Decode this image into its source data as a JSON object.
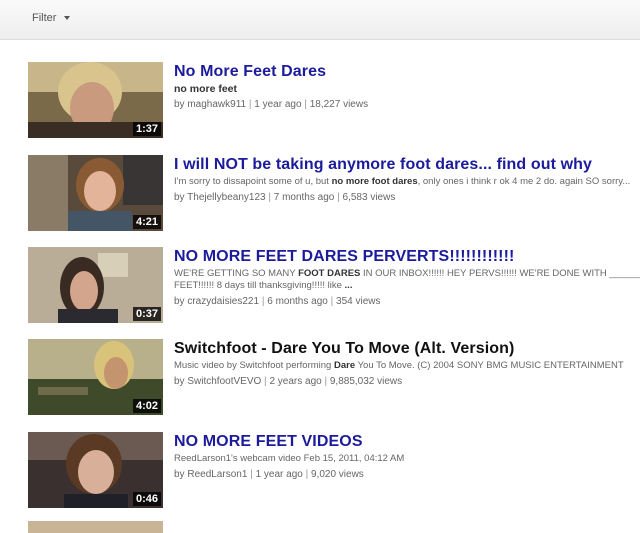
{
  "filter": {
    "label": "Filter"
  },
  "results": [
    {
      "title": "No More Feet Dares",
      "desc": [
        {
          "t": "no more feet",
          "b": false
        }
      ],
      "desc_style": "strong",
      "user": "maghawk911",
      "age": "1 year ago",
      "views": "18,227 views",
      "duration": "1:37"
    },
    {
      "title": "I will NOT be taking anymore foot dares... find out why",
      "desc": [
        {
          "t": "I'm sorry to dissapoint some of u, but ",
          "b": false
        },
        {
          "t": "no more foot dares",
          "b": true
        },
        {
          "t": ", only ones i think r ok 4 me 2 do. again SO sorry...",
          "b": false
        }
      ],
      "user": "Thejellybeany123",
      "age": "7 months ago",
      "views": "6,583 views",
      "duration": "4:21"
    },
    {
      "title": "NO MORE FEET DARES PERVERTS!!!!!!!!!!!!",
      "desc": [
        {
          "t": "WE'RE GETTING SO MANY ",
          "b": false
        },
        {
          "t": "FOOT DARES",
          "b": true
        },
        {
          "t": " IN OUR INBOX!!!!!! HEY PERVS!!!!!! WE'RE DONE WITH ______ FEET!!!!!! 8 days till thanksgiving!!!!! like ",
          "b": false
        },
        {
          "t": "...",
          "b": true
        }
      ],
      "user": "crazydaisies221",
      "age": "6 months ago",
      "views": "354 views",
      "duration": "0:37"
    },
    {
      "title": "Switchfoot - Dare You To Move (Alt. Version)",
      "title_style": "dark",
      "desc": [
        {
          "t": "Music video by Switchfoot performing ",
          "b": false
        },
        {
          "t": "Dare",
          "b": true
        },
        {
          "t": " You To Move. (C) 2004 SONY BMG MUSIC ENTERTAINMENT",
          "b": false
        }
      ],
      "user": "SwitchfootVEVO",
      "age": "2 years ago",
      "views": "9,885,032 views",
      "duration": "4:02"
    },
    {
      "title": "NO MORE FEET VIDEOS",
      "desc": [
        {
          "t": "ReedLarson1's webcam video Feb 15, 2011, 04:12 AM",
          "b": false
        }
      ],
      "user": "ReedLarson1",
      "age": "1 year ago",
      "views": "9,020 views",
      "duration": "0:46"
    }
  ]
}
